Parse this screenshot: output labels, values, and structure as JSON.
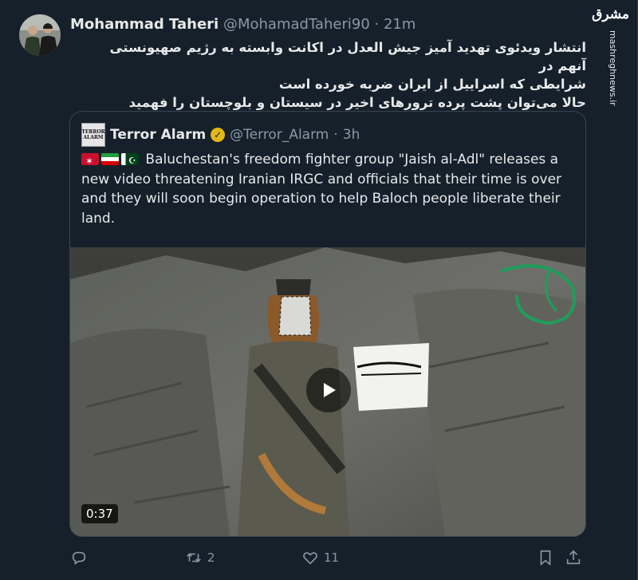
{
  "tweet": {
    "author_name": "Mohammad Taheri",
    "author_handle": "@MohamadTaheri90",
    "separator": "·",
    "time": "21m",
    "lines": [
      "انتشار ویدئوی تهدید آمیز جیش العدل در اکانت وابسته به رژیم صهیونستی آنهم در",
      "شرایطی که اسراییل از ایران ضربه خورده است",
      "حالا می‌توان پشت پرده ترورهای اخیر در سیستان و بلوچستان را فهمید"
    ]
  },
  "watermark": {
    "logo": "مشرق",
    "url": "mashreghnews.ir"
  },
  "quoted": {
    "avatar_line1": "TERROR",
    "avatar_line2": "ALARM",
    "name": "Terror Alarm",
    "handle": "@Terror_Alarm",
    "separator": "·",
    "time": "3h",
    "text": "Baluchestan's freedom fighter group \"Jaish al-Adl\" releases a new video threatening Iranian IRGC and officials that their time is over and they will soon begin operation to help Baloch people liberate their land.",
    "video_duration": "0:37",
    "banner_text": "الله اکبر"
  },
  "actions": {
    "replies": "",
    "retweets": "2",
    "likes": "11"
  },
  "colors": {
    "background": "#15202b",
    "secondary_text": "#8b98a5",
    "border": "#38444d",
    "verified": "#e2b719"
  }
}
